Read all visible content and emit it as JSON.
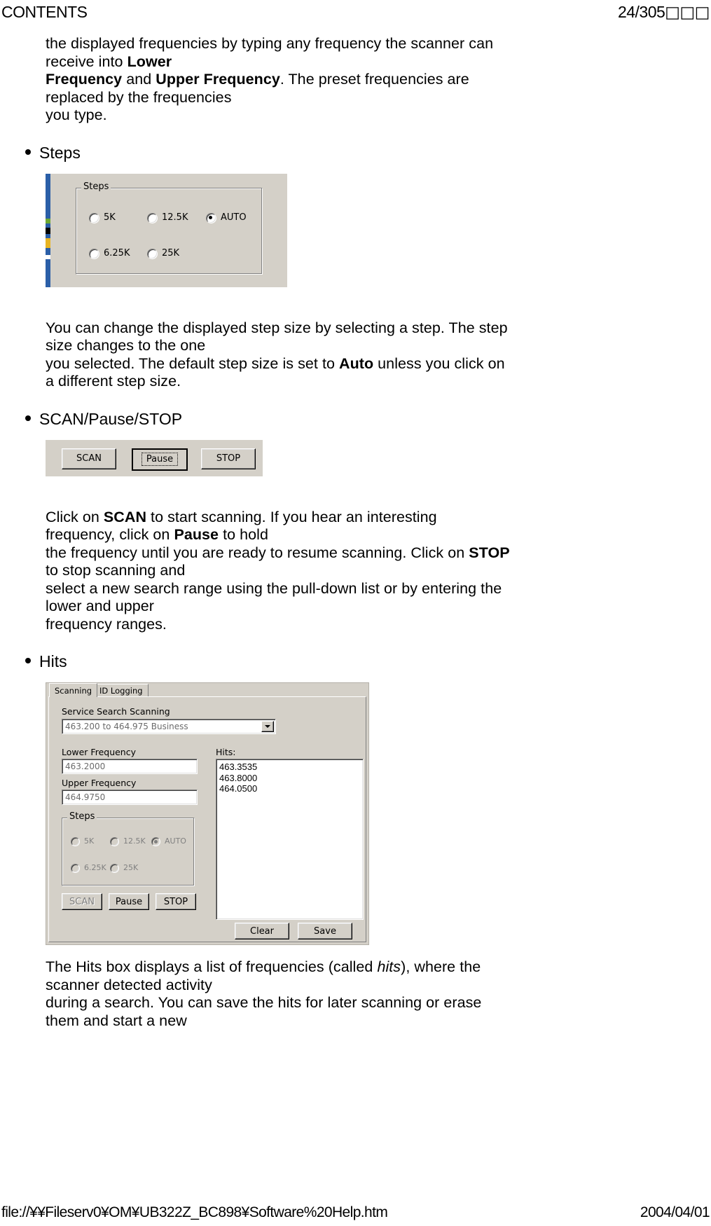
{
  "header": {
    "title": "CONTENTS",
    "page_indicator": "24/305",
    "page_unit_glyphs": "□□□"
  },
  "footer": {
    "path": "file://¥¥Fileserv0¥OM¥UB322Z_BC898¥Software%20Help.htm",
    "date": "2004/04/01"
  },
  "content": {
    "intro_paragraph": {
      "line1": "the displayed frequencies by typing any frequency the scanner can",
      "line2_pre": "receive into ",
      "line2_bold": "Lower",
      "line3_bold1": "Frequency",
      "line3_mid": " and ",
      "line3_bold2": "Upper Frequency",
      "line3_post": ".  The preset frequencies are",
      "line4": "replaced by the frequencies",
      "line5": "you type."
    },
    "bullet_steps": "Steps",
    "steps_paragraph": {
      "line1": "You can change the displayed step size by selecting a step. The step",
      "line2": "size changes to the one",
      "line3_pre": "you selected.  The default step size is set to ",
      "line3_bold": "Auto",
      "line3_post": " unless you click on",
      "line4": "a different step size."
    },
    "bullet_scan": "SCAN/Pause/STOP",
    "scan_paragraph": {
      "line1_pre": "Click on ",
      "line1_bold": "SCAN",
      "line1_mid": " to start scanning.  If you hear an interesting",
      "line2_pre": "frequency, click on ",
      "line2_bold": "Pause",
      "line2_post": " to hold",
      "line3_pre": "the frequency until you are ready to resume scanning. Click on ",
      "line3_bold": "STOP",
      "line4": "to stop scanning and",
      "line5": "select a new search range using the pull-down list or by entering the",
      "line6": "lower and upper",
      "line7": "frequency ranges."
    },
    "bullet_hits": "Hits",
    "hits_paragraph": {
      "line1_pre": "The Hits box displays a list of frequencies (called ",
      "line1_italic": "hits",
      "line1_post": "), where the",
      "line2": "scanner detected activity",
      "line3": "during a search.  You can save the hits for later scanning or erase",
      "line4": "them and start a new"
    }
  },
  "figure_steps": {
    "group_caption": "Steps",
    "options": [
      {
        "label": "5K",
        "checked": false
      },
      {
        "label": "12.5K",
        "checked": false
      },
      {
        "label": "AUTO",
        "checked": true
      },
      {
        "label": "6.25K",
        "checked": false
      },
      {
        "label": "25K",
        "checked": false
      }
    ]
  },
  "figure_scan_buttons": {
    "scan": "SCAN",
    "pause": "Pause",
    "stop": "STOP"
  },
  "figure_hits": {
    "tabs": [
      {
        "label": "Scanning",
        "active": true
      },
      {
        "label": "ID Logging",
        "active": false
      }
    ],
    "service_search_label": "Service Search Scanning",
    "service_search_value": "463.200 to 464.975  Business",
    "lower_frequency_label": "Lower Frequency",
    "lower_frequency_value": "463.2000",
    "upper_frequency_label": "Upper Frequency",
    "upper_frequency_value": "464.9750",
    "steps_caption": "Steps",
    "steps_options": [
      {
        "label": "5K",
        "checked": false
      },
      {
        "label": "12.5K",
        "checked": false
      },
      {
        "label": "AUTO",
        "checked": true
      },
      {
        "label": "6.25K",
        "checked": false
      },
      {
        "label": "25K",
        "checked": false
      }
    ],
    "scan_button": "SCAN",
    "pause_button": "Pause",
    "stop_button": "STOP",
    "hits_label": "Hits:",
    "hits_values": [
      "463.3535",
      "463.8000",
      "464.0500"
    ],
    "clear_button": "Clear",
    "save_button": "Save"
  }
}
